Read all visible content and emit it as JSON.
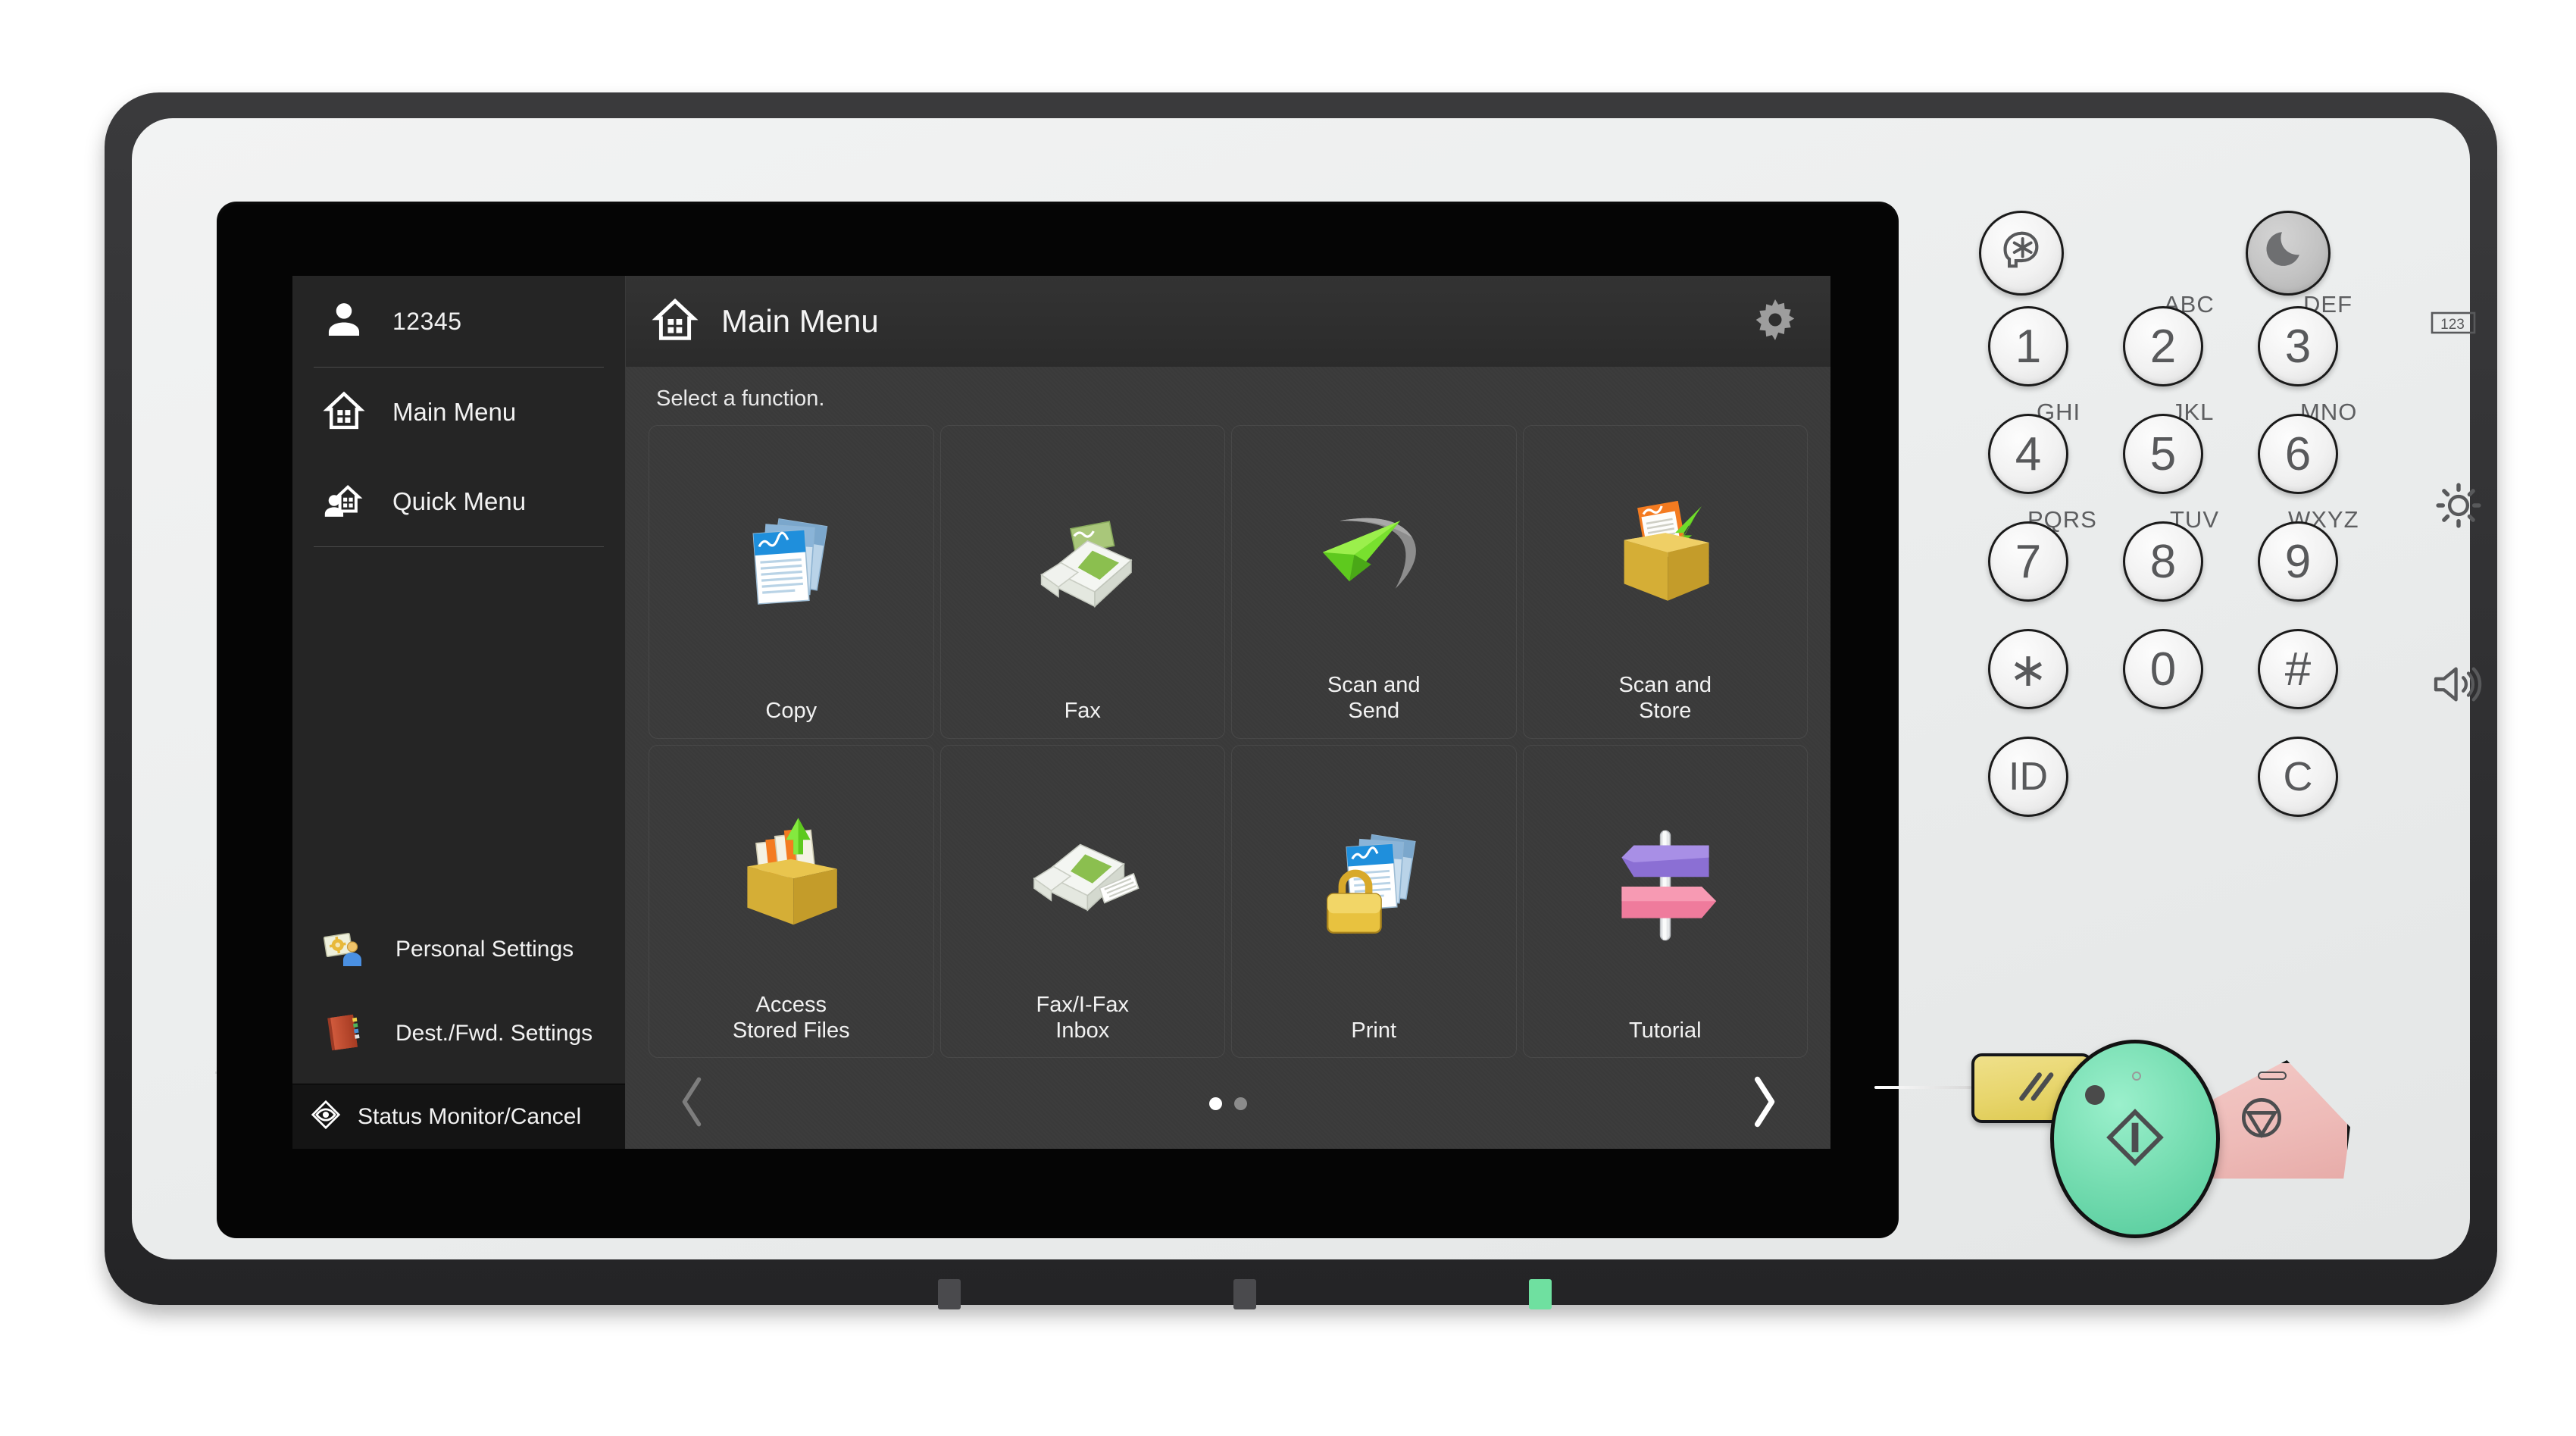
{
  "device": {
    "name": "multifunction-printer-control-panel"
  },
  "screen": {
    "sidebar": {
      "user": {
        "id": "12345",
        "icon": "user-icon"
      },
      "items": [
        {
          "label": "Main Menu",
          "icon": "home-icon"
        },
        {
          "label": "Quick Menu",
          "icon": "user-home-icon"
        }
      ],
      "bottom_items": [
        {
          "label": "Personal\nSettings",
          "icon": "personal-settings-icon"
        },
        {
          "label": "Dest./Fwd.\nSettings",
          "icon": "address-book-icon"
        }
      ],
      "status": {
        "label": "Status Monitor/Cancel",
        "icon": "eye-diamond-icon"
      }
    },
    "header": {
      "title": "Main Menu",
      "home_icon": "home-icon",
      "settings_icon": "gear-icon"
    },
    "hint": "Select a function.",
    "functions": [
      {
        "label": "Copy",
        "icon": "documents-blue-icon"
      },
      {
        "label": "Fax",
        "icon": "fax-machine-icon"
      },
      {
        "label": "Scan and\nSend",
        "icon": "paper-plane-icon"
      },
      {
        "label": "Scan and\nStore",
        "icon": "box-in-arrow-icon"
      },
      {
        "label": "Access\nStored Files",
        "icon": "file-box-icon"
      },
      {
        "label": "Fax/I-Fax\nInbox",
        "icon": "fax-inbox-icon"
      },
      {
        "label": "Print",
        "icon": "documents-lock-icon"
      },
      {
        "label": "Tutorial",
        "icon": "signpost-icon"
      }
    ],
    "pager": {
      "prev_icon": "chevron-left-icon",
      "next_icon": "chevron-right-icon",
      "pages": 2,
      "current_page": 1
    }
  },
  "keypad": {
    "energy_saver": {
      "icon": "energy-saver-icon"
    },
    "sleep": {
      "icon": "moon-icon"
    },
    "keys": [
      {
        "digit": "1",
        "letters": ""
      },
      {
        "digit": "2",
        "letters": "ABC"
      },
      {
        "digit": "3",
        "letters": "DEF"
      },
      {
        "digit": "4",
        "letters": "GHI"
      },
      {
        "digit": "5",
        "letters": "JKL"
      },
      {
        "digit": "6",
        "letters": "MNO"
      },
      {
        "digit": "7",
        "letters": "PQRS"
      },
      {
        "digit": "8",
        "letters": "TUV"
      },
      {
        "digit": "9",
        "letters": "WXYZ"
      },
      {
        "digit": "∗",
        "letters": ""
      },
      {
        "digit": "0",
        "letters": ""
      },
      {
        "digit": "#",
        "letters": ""
      }
    ],
    "id_key": "ID",
    "clear_key": "C"
  },
  "indicators": [
    {
      "icon": "numeric-123-icon",
      "label": "123"
    },
    {
      "icon": "brightness-icon",
      "label": ""
    },
    {
      "icon": "volume-icon",
      "label": ""
    }
  ],
  "actions": {
    "reset": {
      "icon": "reset-slashes-icon"
    },
    "start": {
      "icon": "start-diamond-icon"
    },
    "stop": {
      "icon": "stop-circle-icon"
    }
  },
  "colors": {
    "start": "#74dcb0",
    "stop": "#eebbb8",
    "reset": "#e8d66e",
    "screen_bg": "#3a3a3a",
    "sidebar_bg": "#252525",
    "accent_green": "#6fe0a0"
  }
}
